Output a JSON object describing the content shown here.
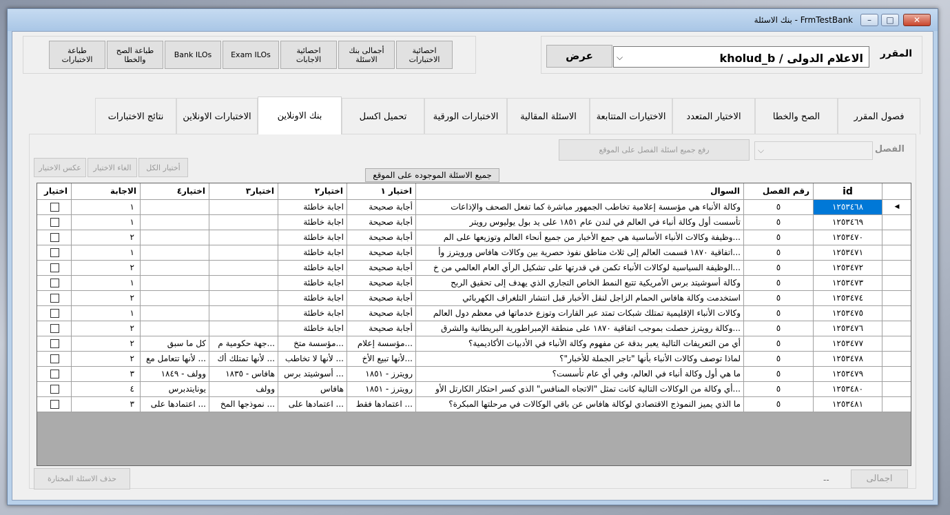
{
  "window": {
    "title": "FrmTestBank - بنك الاسئلة",
    "minimize": "–",
    "maximize": "□",
    "close": "✕"
  },
  "course": {
    "label": "المقرر",
    "value": "الاعلام الدولى / kholud_b",
    "show_button": "عرض"
  },
  "toolbar": {
    "exam_stats": "احصائية الاختبارات",
    "bank_totals": "أجمالى بنك الاسئلة",
    "answer_stats": "احصائية الاجابات",
    "exam_ilos": "Exam ILOs",
    "bank_ilos": "Bank ILOs",
    "print_tf": "طباعة الصح والخطا",
    "print_exams": "طباعة الاختبارات"
  },
  "tabs": [
    "فصول المقرر",
    "الصح والخطا",
    "الاختيار المتعدد",
    "الاختيارات المتتابعة",
    "الاسئلة المقالية",
    "الاختبارات الورقية",
    "تحميل اكسل",
    "بنك الاونلاين",
    "الاختبارات الاونلاين",
    "نتائج الاختبارات"
  ],
  "online_bank": {
    "chapter_label": "الفصل",
    "upload_button": "رفع جميع اسئلة الفصل على الموقع",
    "select_all": "أختيار الكل",
    "deselect": "الغاء الاختيار",
    "invert": "عكس الاختيار",
    "all_on_site_button": "جميع الاسئلة الموجوده على الموقع",
    "delete_selected": "حذف الاسئلة المختارة",
    "total_button": "اجمالى",
    "total_value": "--"
  },
  "table": {
    "columns": [
      "id",
      "رقم الفصل",
      "السوال",
      "اختيار ١",
      "اختيار٢",
      "اختيار٣",
      "اختيار٤",
      "الاجابة",
      "اختيار"
    ],
    "rows": [
      [
        "١٢٥٣٤٦٨",
        "٥",
        "وكالة الأنباء هي مؤسسة إعلامية تخاطب الجمهور مباشرة كما تفعل الصحف والإذاعات",
        "أجابة صحيحة",
        "اجابة خاطئة",
        "",
        "",
        "١"
      ],
      [
        "١٢٥٣٤٦٩",
        "٥",
        "تأسست أول وكالة أنباء في العالم في لندن عام ١٨٥١ على يد بول يوليوس رويتر",
        "أجابة صحيحة",
        "اجابة خاطئة",
        "",
        "",
        "١"
      ],
      [
        "١٢٥٣٤٧٠",
        "٥",
        "...وظيفة وكالات الأنباء الأساسية هي جمع الأخبار من جميع أنحاء العالم وتوزيعها على الم",
        "أجابة صحيحة",
        "اجابة خاطئة",
        "",
        "",
        "٢"
      ],
      [
        "١٢٥٣٤٧١",
        "٥",
        "...اتفاقية ١٨٧٠ قسمت العالم إلى ثلاث مناطق نفوذ حصرية بين وكالات هافاس ورويترز وأ",
        "أجابة صحيحة",
        "اجابة خاطئة",
        "",
        "",
        "١"
      ],
      [
        "١٢٥٣٤٧٢",
        "٥",
        "...الوظيفة السياسية لوكالات الأنباء تكمن في قدرتها على تشكيل الرأي العام العالمي من خ",
        "أجابة صحيحة",
        "اجابة خاطئة",
        "",
        "",
        "٢"
      ],
      [
        "١٢٥٣٤٧٣",
        "٥",
        "وكالة أسوشيتد برس الأمريكية تتبع النمط الخاص التجاري الذي يهدف إلى تحقيق الربح",
        "أجابة صحيحة",
        "اجابة خاطئة",
        "",
        "",
        "١"
      ],
      [
        "١٢٥٣٤٧٤",
        "٥",
        "استخدمت وكالة هافاس الحمام الزاجل لنقل الأخبار قبل انتشار التلغراف الكهربائي",
        "أجابة صحيحة",
        "اجابة خاطئة",
        "",
        "",
        "٢"
      ],
      [
        "١٢٥٣٤٧٥",
        "٥",
        "وكالات الأنباء الإقليمية تمتلك شبكات تمتد عبر القارات وتوزع خدماتها في معظم دول العالم",
        "أجابة صحيحة",
        "اجابة خاطئة",
        "",
        "",
        "١"
      ],
      [
        "١٢٥٣٤٧٦",
        "٥",
        "...وكالة رويترز حصلت بموجب اتفاقية ١٨٧٠ على منطقة الإمبراطورية البريطانية والشرق",
        "أجابة صحيحة",
        "اجابة خاطئة",
        "",
        "",
        "٢"
      ],
      [
        "١٢٥٣٤٧٧",
        "٥",
        "أي من التعريفات التالية يعبر بدقة عن مفهوم وكالة الأنباء في الأدبيات الأكاديمية؟",
        "...مؤسسة إعلام",
        "...مؤسسة متخ",
        "...جهة حكومية م",
        "كل ما سبق",
        "٢"
      ],
      [
        "١٢٥٣٤٧٨",
        "٥",
        "لماذا توصف وكالات الأنباء بأنها \"تاجر الجملة للأخبار\"؟",
        "...لأنها تبيع الأخ",
        "... لأنها لا تخاطب",
        "... لأنها تمتلك أك",
        "... لأنها تتعامل مع",
        "٢"
      ],
      [
        "١٢٥٣٤٧٩",
        "٥",
        "ما هي أول وكالة أنباء في العالم، وفي أي عام تأسست؟",
        "رويترز - ١٨٥١",
        "... أسوشيتد برس",
        "هافاس - ١٨٣٥",
        "وولف - ١٨٤٩",
        "٣"
      ],
      [
        "١٢٥٣٤٨٠",
        "٥",
        "...أي وكالة من الوكالات التالية كانت تمثل \"الاتجاه المنافس\" الذي كسر احتكار الكارتل الأو",
        "رويترز - ١٨٥١",
        "هافاس",
        "وولف",
        "يونايتدبرس",
        "٤"
      ],
      [
        "١٢٥٣٤٨١",
        "٥",
        "ما الذي يميز النموذج الاقتصادي لوكالة هافاس عن باقي الوكالات في مرحلتها المبكرة؟",
        "... اعتمادها فقط",
        "... اعتمادها على",
        "... نموذجها المخ",
        "... اعتمادها على",
        "٣"
      ]
    ]
  }
}
